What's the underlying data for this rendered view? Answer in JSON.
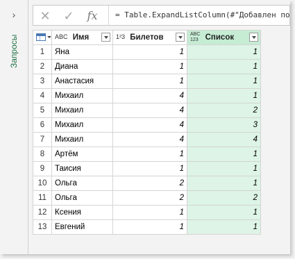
{
  "queries_pane": {
    "label": "Запросы",
    "toggle_glyph": "›",
    "toggle_icon": "chevron-right-icon"
  },
  "formula_bar": {
    "cancel_glyph": "✕",
    "confirm_glyph": "✓",
    "fx_label": "fx",
    "formula": "= Table.ExpandListColumn(#\"Добавлен пол"
  },
  "colors": {
    "selected_header": "#c6ecd4",
    "selected_cells": "#ddf4e6",
    "queries_label": "#217346"
  },
  "columns": [
    {
      "type_line1": "A",
      "type_line2": "B C",
      "type_text": "ABC",
      "label": "Имя",
      "selected": false
    },
    {
      "type_text": "1²3",
      "label": "Билетов",
      "selected": false
    },
    {
      "type_line1": "ABC",
      "type_line2": "123",
      "label": "Список",
      "selected": true
    }
  ],
  "rows": [
    {
      "n": "1",
      "name": "Яна",
      "tickets": "1",
      "list": "1"
    },
    {
      "n": "2",
      "name": "Диана",
      "tickets": "1",
      "list": "1"
    },
    {
      "n": "3",
      "name": "Анастасия",
      "tickets": "1",
      "list": "1"
    },
    {
      "n": "4",
      "name": "Михаил",
      "tickets": "4",
      "list": "1"
    },
    {
      "n": "5",
      "name": "Михаил",
      "tickets": "4",
      "list": "2"
    },
    {
      "n": "6",
      "name": "Михаил",
      "tickets": "4",
      "list": "3"
    },
    {
      "n": "7",
      "name": "Михаил",
      "tickets": "4",
      "list": "4"
    },
    {
      "n": "8",
      "name": "Артём",
      "tickets": "1",
      "list": "1"
    },
    {
      "n": "9",
      "name": "Таисия",
      "tickets": "1",
      "list": "1"
    },
    {
      "n": "10",
      "name": "Ольга",
      "tickets": "2",
      "list": "1"
    },
    {
      "n": "11",
      "name": "Ольга",
      "tickets": "2",
      "list": "2"
    },
    {
      "n": "12",
      "name": "Ксения",
      "tickets": "1",
      "list": "1"
    },
    {
      "n": "13",
      "name": "Евгений",
      "tickets": "1",
      "list": "1"
    }
  ]
}
